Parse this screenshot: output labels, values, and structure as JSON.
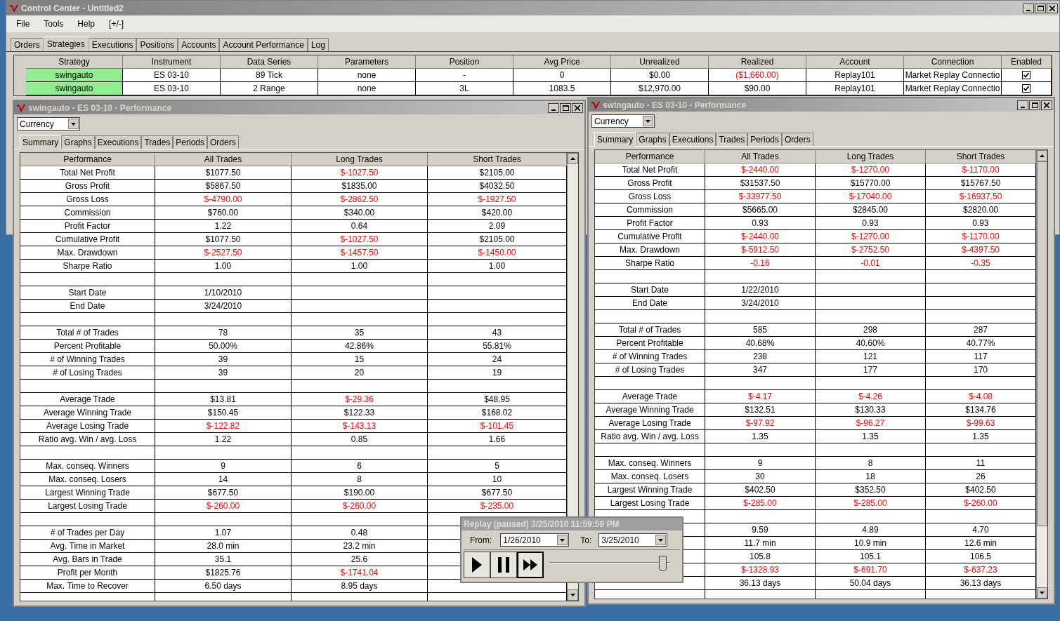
{
  "window": {
    "title": "Control Center - Untitled2"
  },
  "menu": [
    "File",
    "Tools",
    "Help",
    "[+/-]"
  ],
  "tabs": [
    {
      "label": "Orders",
      "selected": false
    },
    {
      "label": "Strategies",
      "selected": true
    },
    {
      "label": "Executions",
      "selected": false
    },
    {
      "label": "Positions",
      "selected": false
    },
    {
      "label": "Accounts",
      "selected": false
    },
    {
      "label": "Account Performance",
      "selected": false
    },
    {
      "label": "Log",
      "selected": false
    }
  ],
  "strategies": {
    "columns": [
      "Strategy",
      "Instrument",
      "Data Series",
      "Parameters",
      "Position",
      "Avg Price",
      "Unrealized",
      "Realized",
      "Account",
      "Connection",
      "Enabled"
    ],
    "rows": [
      {
        "running": true,
        "cells": [
          "swingauto",
          "ES 03-10",
          "89 Tick",
          "none",
          "-",
          "0",
          "$0.00",
          "($1,660.00)",
          "Replay101",
          "Market Replay Connectio"
        ],
        "negative": [
          false,
          false,
          false,
          false,
          false,
          false,
          false,
          true,
          false,
          false
        ],
        "enabled": true
      },
      {
        "running": true,
        "cells": [
          "swingauto",
          "ES 03-10",
          "2 Range",
          "none",
          "3L",
          "1083.5",
          "$12,970.00",
          "$90.00",
          "Replay101",
          "Market Replay Connectio"
        ],
        "negative": [
          false,
          false,
          false,
          false,
          false,
          false,
          false,
          false,
          false,
          false
        ],
        "enabled": true
      }
    ]
  },
  "performance_windows": [
    {
      "title": "swingauto - ES 03-10 - Performance",
      "selector": "Currency",
      "tabs": [
        {
          "label": "Summary",
          "selected": true
        },
        {
          "label": "Graphs",
          "selected": false
        },
        {
          "label": "Executions",
          "selected": false
        },
        {
          "label": "Trades",
          "selected": false
        },
        {
          "label": "Periods",
          "selected": false
        },
        {
          "label": "Orders",
          "selected": false
        }
      ],
      "columns": [
        "Performance",
        "All Trades",
        "Long Trades",
        "Short Trades"
      ],
      "rows": [
        {
          "kind": "metric",
          "label": "Total Net Profit",
          "cells": [
            "$1077.50",
            "$-1027.50",
            "$2105.00"
          ],
          "negative": [
            false,
            true,
            false
          ]
        },
        {
          "kind": "metric",
          "label": "Gross Profit",
          "cells": [
            "$5867.50",
            "$1835.00",
            "$4032.50"
          ],
          "negative": [
            false,
            false,
            false
          ]
        },
        {
          "kind": "metric",
          "label": "Gross Loss",
          "cells": [
            "$-4790.00",
            "$-2862.50",
            "$-1927.50"
          ],
          "negative": [
            true,
            true,
            true
          ]
        },
        {
          "kind": "metric",
          "label": "Commission",
          "cells": [
            "$760.00",
            "$340.00",
            "$420.00"
          ],
          "negative": [
            false,
            false,
            false
          ]
        },
        {
          "kind": "metric",
          "label": "Profit Factor",
          "cells": [
            "1.22",
            "0.64",
            "2.09"
          ],
          "negative": [
            false,
            false,
            false
          ]
        },
        {
          "kind": "metric",
          "label": "Cumulative Profit",
          "cells": [
            "$1077.50",
            "$-1027.50",
            "$2105.00"
          ],
          "negative": [
            false,
            true,
            false
          ]
        },
        {
          "kind": "metric",
          "label": "Max. Drawdown",
          "cells": [
            "$-2527.50",
            "$-1457.50",
            "$-1450.00"
          ],
          "negative": [
            true,
            true,
            true
          ]
        },
        {
          "kind": "metric",
          "label": "Sharpe Ratio",
          "cells": [
            "1.00",
            "1.00",
            "1.00"
          ],
          "negative": [
            false,
            false,
            false
          ]
        },
        {
          "kind": "blank"
        },
        {
          "kind": "metric",
          "label": "Start Date",
          "cells": [
            "1/10/2010"
          ],
          "negative": [
            false
          ]
        },
        {
          "kind": "metric",
          "label": "End Date",
          "cells": [
            "3/24/2010"
          ],
          "negative": [
            false
          ]
        },
        {
          "kind": "blank"
        },
        {
          "kind": "metric",
          "label": "Total # of Trades",
          "cells": [
            "78",
            "35",
            "43"
          ],
          "negative": [
            false,
            false,
            false
          ]
        },
        {
          "kind": "metric",
          "label": "Percent Profitable",
          "cells": [
            "50.00%",
            "42.86%",
            "55.81%"
          ],
          "negative": [
            false,
            false,
            false
          ]
        },
        {
          "kind": "metric",
          "label": "# of Winning Trades",
          "cells": [
            "39",
            "15",
            "24"
          ],
          "negative": [
            false,
            false,
            false
          ]
        },
        {
          "kind": "metric",
          "label": "# of Losing Trades",
          "cells": [
            "39",
            "20",
            "19"
          ],
          "negative": [
            false,
            false,
            false
          ]
        },
        {
          "kind": "blank"
        },
        {
          "kind": "metric",
          "label": "Average Trade",
          "cells": [
            "$13.81",
            "$-29.36",
            "$48.95"
          ],
          "negative": [
            false,
            true,
            false
          ]
        },
        {
          "kind": "metric",
          "label": "Average Winning Trade",
          "cells": [
            "$150.45",
            "$122.33",
            "$168.02"
          ],
          "negative": [
            false,
            false,
            false
          ]
        },
        {
          "kind": "metric",
          "label": "Average Losing Trade",
          "cells": [
            "$-122.82",
            "$-143.13",
            "$-101.45"
          ],
          "negative": [
            true,
            true,
            true
          ]
        },
        {
          "kind": "metric",
          "label": "Ratio avg. Win / avg. Loss",
          "cells": [
            "1.22",
            "0.85",
            "1.66"
          ],
          "negative": [
            false,
            false,
            false
          ]
        },
        {
          "kind": "blank"
        },
        {
          "kind": "metric",
          "label": "Max. conseq. Winners",
          "cells": [
            "9",
            "6",
            "5"
          ],
          "negative": [
            false,
            false,
            false
          ]
        },
        {
          "kind": "metric",
          "label": "Max. conseq. Losers",
          "cells": [
            "14",
            "8",
            "10"
          ],
          "negative": [
            false,
            false,
            false
          ]
        },
        {
          "kind": "metric",
          "label": "Largest Winning Trade",
          "cells": [
            "$677.50",
            "$190.00",
            "$677.50"
          ],
          "negative": [
            false,
            false,
            false
          ]
        },
        {
          "kind": "metric",
          "label": "Largest Losing Trade",
          "cells": [
            "$-260.00",
            "$-260.00",
            "$-235.00"
          ],
          "negative": [
            true,
            true,
            true
          ]
        },
        {
          "kind": "blank"
        },
        {
          "kind": "metric",
          "label": "# of Trades per Day",
          "cells": [
            "1.07",
            "0.48"
          ],
          "negative": [
            false,
            false
          ]
        },
        {
          "kind": "metric",
          "label": "Avg. Time in Market",
          "cells": [
            "28.0 min",
            "23.2 min"
          ],
          "negative": [
            false,
            false
          ]
        },
        {
          "kind": "metric",
          "label": "Avg. Bars in Trade",
          "cells": [
            "35.1",
            "25.6"
          ],
          "negative": [
            false,
            false
          ]
        },
        {
          "kind": "metric",
          "label": "Profit per Month",
          "cells": [
            "$1825.76",
            "$-1741.04"
          ],
          "negative": [
            false,
            true
          ]
        },
        {
          "kind": "metric",
          "label": "Max. Time to Recover",
          "cells": [
            "6.50 days",
            "8.95 days"
          ],
          "negative": [
            false,
            false
          ]
        },
        {
          "kind": "blank"
        }
      ]
    },
    {
      "title": "swingauto - ES 03-10 - Performance",
      "selector": "Currency",
      "tabs": [
        {
          "label": "Summary",
          "selected": true
        },
        {
          "label": "Graphs",
          "selected": false
        },
        {
          "label": "Executions",
          "selected": false
        },
        {
          "label": "Trades",
          "selected": false
        },
        {
          "label": "Periods",
          "selected": false
        },
        {
          "label": "Orders",
          "selected": false
        }
      ],
      "columns": [
        "Performance",
        "All Trades",
        "Long Trades",
        "Short Trades"
      ],
      "rows": [
        {
          "kind": "metric",
          "label": "Total Net Profit",
          "cells": [
            "$-2440.00",
            "$-1270.00",
            "$-1170.00"
          ],
          "negative": [
            true,
            true,
            true
          ]
        },
        {
          "kind": "metric",
          "label": "Gross Profit",
          "cells": [
            "$31537.50",
            "$15770.00",
            "$15767.50"
          ],
          "negative": [
            false,
            false,
            false
          ]
        },
        {
          "kind": "metric",
          "label": "Gross Loss",
          "cells": [
            "$-33977.50",
            "$-17040.00",
            "$-16937.50"
          ],
          "negative": [
            true,
            true,
            true
          ]
        },
        {
          "kind": "metric",
          "label": "Commission",
          "cells": [
            "$5665.00",
            "$2845.00",
            "$2820.00"
          ],
          "negative": [
            false,
            false,
            false
          ]
        },
        {
          "kind": "metric",
          "label": "Profit Factor",
          "cells": [
            "0.93",
            "0.93",
            "0.93"
          ],
          "negative": [
            false,
            false,
            false
          ]
        },
        {
          "kind": "metric",
          "label": "Cumulative Profit",
          "cells": [
            "$-2440.00",
            "$-1270.00",
            "$-1170.00"
          ],
          "negative": [
            true,
            true,
            true
          ]
        },
        {
          "kind": "metric",
          "label": "Max. Drawdown",
          "cells": [
            "$-5912.50",
            "$-2752.50",
            "$-4397.50"
          ],
          "negative": [
            true,
            true,
            true
          ]
        },
        {
          "kind": "metric",
          "label": "Sharpe Ratio",
          "cells": [
            "-0.16",
            "-0.01",
            "-0.35"
          ],
          "negative": [
            true,
            true,
            true
          ]
        },
        {
          "kind": "blank"
        },
        {
          "kind": "metric",
          "label": "Start Date",
          "cells": [
            "1/22/2010"
          ],
          "negative": [
            false
          ]
        },
        {
          "kind": "metric",
          "label": "End Date",
          "cells": [
            "3/24/2010"
          ],
          "negative": [
            false
          ]
        },
        {
          "kind": "blank"
        },
        {
          "kind": "metric",
          "label": "Total # of Trades",
          "cells": [
            "585",
            "298",
            "287"
          ],
          "negative": [
            false,
            false,
            false
          ]
        },
        {
          "kind": "metric",
          "label": "Percent Profitable",
          "cells": [
            "40.68%",
            "40.60%",
            "40.77%"
          ],
          "negative": [
            false,
            false,
            false
          ]
        },
        {
          "kind": "metric",
          "label": "# of Winning Trades",
          "cells": [
            "238",
            "121",
            "117"
          ],
          "negative": [
            false,
            false,
            false
          ]
        },
        {
          "kind": "metric",
          "label": "# of Losing Trades",
          "cells": [
            "347",
            "177",
            "170"
          ],
          "negative": [
            false,
            false,
            false
          ]
        },
        {
          "kind": "blank"
        },
        {
          "kind": "metric",
          "label": "Average Trade",
          "cells": [
            "$-4.17",
            "$-4.26",
            "$-4.08"
          ],
          "negative": [
            true,
            true,
            true
          ]
        },
        {
          "kind": "metric",
          "label": "Average Winning Trade",
          "cells": [
            "$132.51",
            "$130.33",
            "$134.76"
          ],
          "negative": [
            false,
            false,
            false
          ]
        },
        {
          "kind": "metric",
          "label": "Average Losing Trade",
          "cells": [
            "$-97.92",
            "$-96.27",
            "$-99.63"
          ],
          "negative": [
            true,
            true,
            true
          ]
        },
        {
          "kind": "metric",
          "label": "Ratio avg. Win / avg. Loss",
          "cells": [
            "1.35",
            "1.35",
            "1.35"
          ],
          "negative": [
            false,
            false,
            false
          ]
        },
        {
          "kind": "blank"
        },
        {
          "kind": "metric",
          "label": "Max. conseq. Winners",
          "cells": [
            "9",
            "8",
            "11"
          ],
          "negative": [
            false,
            false,
            false
          ]
        },
        {
          "kind": "metric",
          "label": "Max. conseq. Losers",
          "cells": [
            "30",
            "18",
            "26"
          ],
          "negative": [
            false,
            false,
            false
          ]
        },
        {
          "kind": "metric",
          "label": "Largest Winning Trade",
          "cells": [
            "$402.50",
            "$352.50",
            "$402.50"
          ],
          "negative": [
            false,
            false,
            false
          ]
        },
        {
          "kind": "metric",
          "label": "Largest Losing Trade",
          "cells": [
            "$-285.00",
            "$-285.00",
            "$-260.00"
          ],
          "negative": [
            true,
            true,
            true
          ]
        },
        {
          "kind": "blank"
        },
        {
          "kind": "metric",
          "cells": [
            "9.59",
            "4.89",
            "4.70"
          ],
          "negative": [
            false,
            false,
            false
          ]
        },
        {
          "kind": "metric",
          "cells": [
            "11.7 min",
            "10.9 min",
            "12.6 min"
          ],
          "negative": [
            false,
            false,
            false
          ]
        },
        {
          "kind": "metric",
          "cells": [
            "105.8",
            "105.1",
            "106.5"
          ],
          "negative": [
            false,
            false,
            false
          ]
        },
        {
          "kind": "metric",
          "cells": [
            "$-1328.93",
            "$-691.70",
            "$-637.23"
          ],
          "negative": [
            true,
            true,
            true
          ]
        },
        {
          "kind": "metric",
          "cells": [
            "36.13 days",
            "50.04 days",
            "36.13 days"
          ],
          "negative": [
            false,
            false,
            false
          ]
        },
        {
          "kind": "blank"
        }
      ]
    }
  ],
  "replay": {
    "title": "Replay (paused) 3/25/2010 11:59:59 PM",
    "from_label": "From:",
    "from": "1/26/2010",
    "to_label": "To:",
    "to": "3/25/2010",
    "level": 0.97
  }
}
